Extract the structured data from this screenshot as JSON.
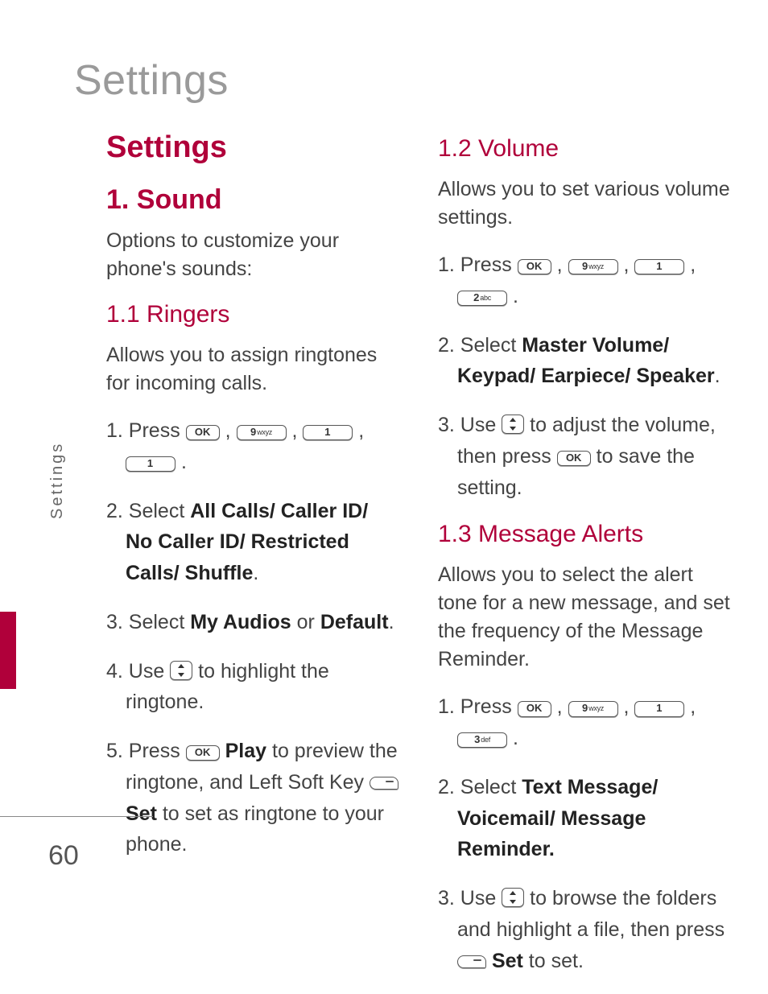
{
  "pageTitle": "Settings",
  "sideLabel": "Settings",
  "pageNumber": "60",
  "left": {
    "sectionHeading": "Settings",
    "sub1": "1. Sound",
    "intro": "Options to customize your phone's sounds:",
    "ringers": {
      "heading": "1.1 Ringers",
      "desc": "Allows you to assign ringtones for incoming calls.",
      "s1a": "1. Press ",
      "s2a": "2. Select ",
      "s2b": "All Calls/ Caller ID/ No Caller ID/ Restricted Calls/ Shuffle",
      "s3a": "3. Select ",
      "s3b": "My Audios",
      "s3c": " or ",
      "s3d": "Default",
      "s4a": "4. Use ",
      "s4b": " to highlight the ringtone.",
      "s5a": "5. Press ",
      "s5play": "Play",
      "s5b": " to preview the ringtone, and Left Soft Key ",
      "s5set": "Set",
      "s5c": " to set as ringtone to your phone."
    }
  },
  "right": {
    "volume": {
      "heading": "1.2 Volume",
      "desc": "Allows you to set various volume settings.",
      "s1a": "1. Press ",
      "s2a": "2. Select ",
      "s2b": "Master Volume/ Keypad/ Earpiece/ Speaker",
      "s3a": "3. Use ",
      "s3b": " to adjust the volume, then press ",
      "s3c": " to save the setting."
    },
    "alerts": {
      "heading": "1.3 Message Alerts",
      "desc": "Allows you to select the alert tone for a new message, and set the frequency of the Message Reminder.",
      "s1a": "1. Press ",
      "s2a": "2. Select ",
      "s2b": "Text Message/ Voicemail/ Message Reminder.",
      "s3a": "3. Use ",
      "s3b": " to browse the folders and highlight a file, then press ",
      "s3set": "Set",
      "s3c": " to set."
    }
  },
  "keys": {
    "ok": "OK",
    "k9": "9",
    "k9s": "wxyz",
    "k1": "1",
    "k1s": "",
    "k2": "2",
    "k2s": "abc",
    "k3": "3",
    "k3s": "def"
  },
  "sep": " ,  ",
  "dot": " ."
}
